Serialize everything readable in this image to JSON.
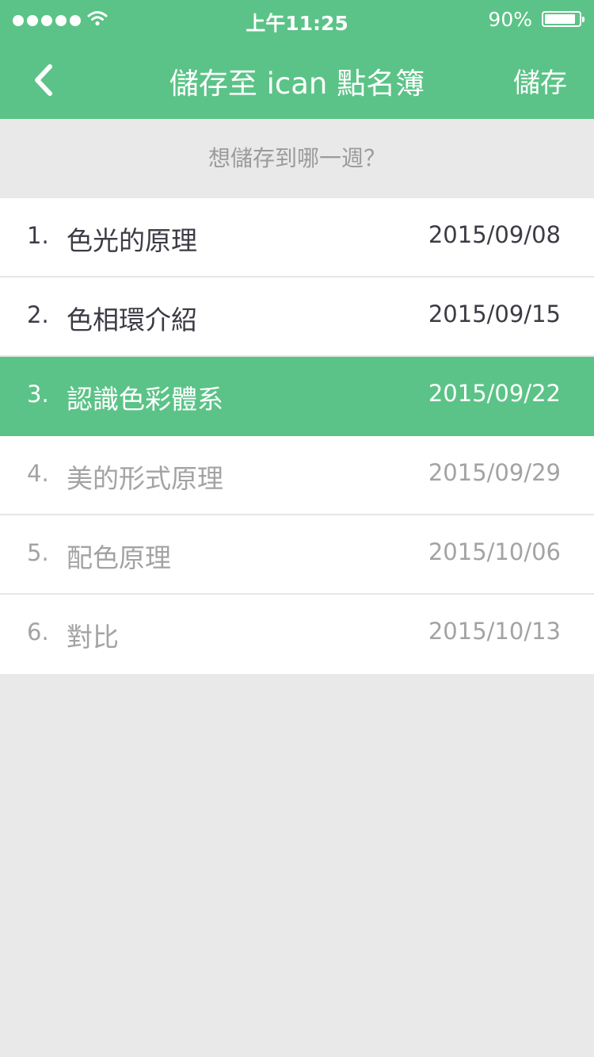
{
  "status_bar": {
    "time": "上午11:25",
    "battery_percent": "90%",
    "battery_level": 0.9,
    "signal_icon": "signal-dots-icon",
    "wifi_icon": "wifi-icon"
  },
  "nav": {
    "back_icon": "chevron-left-icon",
    "title": "儲存至 ican 點名簿",
    "save_label": "儲存"
  },
  "prompt": "想儲存到哪一週？",
  "weeks": [
    {
      "num": "1.",
      "label": "色光的原理",
      "date": "2015/09/08",
      "state": "past"
    },
    {
      "num": "2.",
      "label": "色相環介紹",
      "date": "2015/09/15",
      "state": "past"
    },
    {
      "num": "3.",
      "label": "認識色彩體系",
      "date": "2015/09/22",
      "state": "selected"
    },
    {
      "num": "4.",
      "label": "美的形式原理",
      "date": "2015/09/29",
      "state": "future"
    },
    {
      "num": "5.",
      "label": "配色原理",
      "date": "2015/10/06",
      "state": "future"
    },
    {
      "num": "6.",
      "label": "對比",
      "date": "2015/10/13",
      "state": "future"
    }
  ],
  "colors": {
    "accent": "#5bc387",
    "background": "#e9e9e9",
    "text_dark": "#3c3c46",
    "text_muted": "#a3a3a3"
  }
}
